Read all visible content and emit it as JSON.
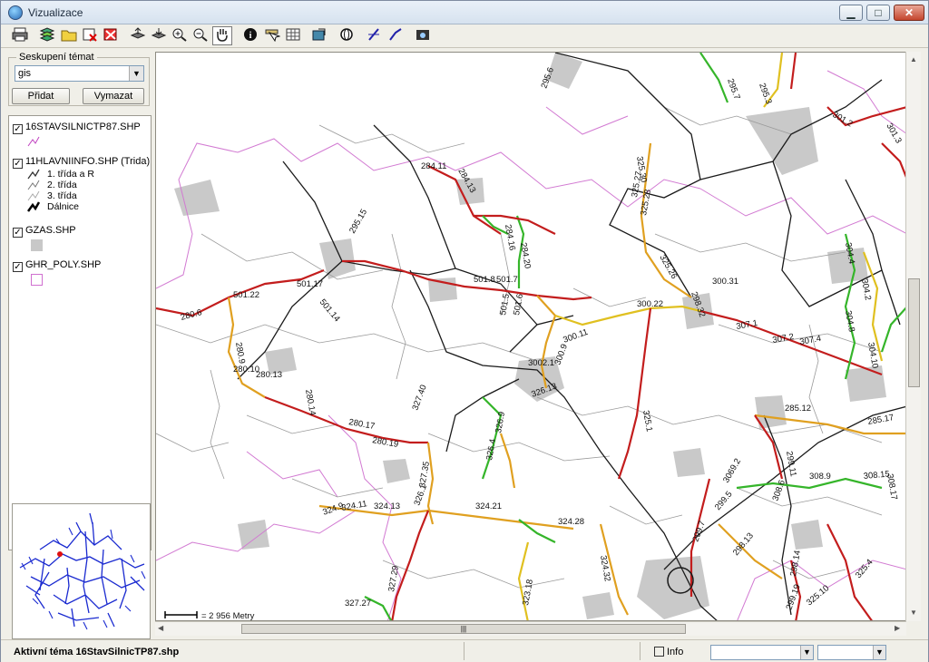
{
  "window": {
    "title": "Vizualizace"
  },
  "window_controls": {
    "minimize": "▁",
    "maximize": "□",
    "close": "✕"
  },
  "toolbar": {
    "buttons": [
      "print",
      "layers",
      "folder",
      "delete-theme",
      "delete-all",
      "layer-up",
      "layer-down",
      "zoom-in",
      "zoom-out",
      "pan",
      "info",
      "select",
      "table",
      "export",
      "globe",
      "line-a",
      "line-b",
      "snapshot"
    ]
  },
  "theme_group": {
    "label": "Seskupení témat",
    "selected": "gis",
    "add_button": "Přidat",
    "clear_button": "Vymazat"
  },
  "layers": [
    {
      "name": "16STAVSILNICTP87.SHP",
      "checked": true
    },
    {
      "name": "11HLAVNIINFO.SHP (Trida)",
      "checked": true,
      "classes": [
        "1. třída a R",
        "2. třída",
        "3. třída",
        "Dálnice"
      ]
    },
    {
      "name": "GZAS.SHP",
      "checked": true
    },
    {
      "name": "GHR_POLY.SHP",
      "checked": true
    }
  ],
  "map": {
    "scale_label": "= 2 956 Metry",
    "road_labels": [
      "295.6",
      "284.11",
      "284.13",
      "295.15",
      "284.16",
      "284.20",
      "501.8",
      "501.7",
      "501.5",
      "501.6",
      "501.22",
      "501.17",
      "501.14",
      "280.6",
      "280.9",
      "280.10",
      "280.13",
      "280.14",
      "280.17",
      "280.19",
      "3002.1",
      "300.9",
      "300.11",
      "326.13",
      "327.40",
      "326.9",
      "326.4",
      "327.35",
      "324.9",
      "324.11",
      "324.13",
      "326.1",
      "324.21",
      "324.28",
      "324.32",
      "327.29",
      "323.18",
      "327.27",
      "325.30",
      "325.27",
      "325.28",
      "325.26",
      "300.22",
      "300.31",
      "298.32",
      "295.7",
      "295.3",
      "301.2",
      "301.3",
      "304.4",
      "304.2",
      "304.8",
      "304.10",
      "307.1",
      "307.2",
      "307.4",
      "285.12",
      "285.17",
      "299.11",
      "308.9",
      "308.15",
      "308.17",
      "3069.2",
      "299.5",
      "308.6",
      "299.7",
      "298.13",
      "298.14",
      "299.19",
      "325.10",
      "325.4",
      "325.1"
    ]
  },
  "status": {
    "active_theme": "Aktivní téma 16StavSilnicTP87.shp",
    "info_label": "Info",
    "info_checked": false
  }
}
